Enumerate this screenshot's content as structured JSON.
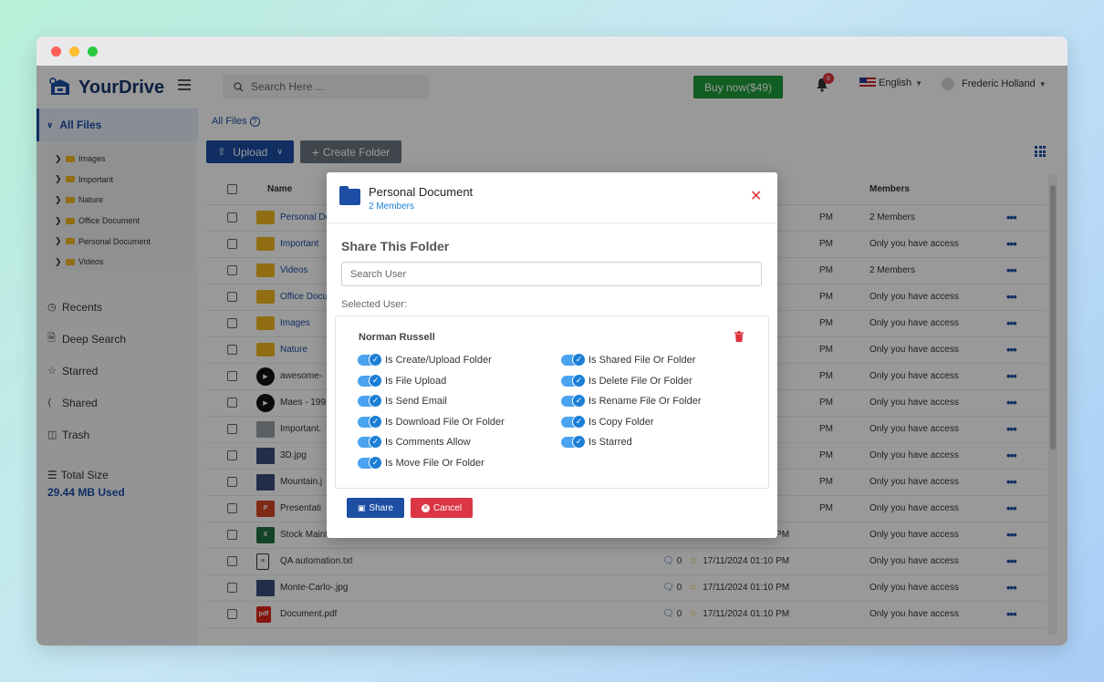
{
  "header": {
    "logo": "YourDrive",
    "search_placeholder": "Search Here ...",
    "buy_label": "Buy now($49)",
    "notification_count": "6",
    "language": "English",
    "user_name": "Frederic Holland"
  },
  "sidebar": {
    "all_files": "All Files",
    "tree": [
      "Images",
      "Important",
      "Nature",
      "Office Document",
      "Personal Document",
      "Videos"
    ],
    "nav": [
      {
        "label": "Recents",
        "icon": "clock-icon"
      },
      {
        "label": "Deep Search",
        "icon": "document-search-icon"
      },
      {
        "label": "Starred",
        "icon": "star-icon"
      },
      {
        "label": "Shared",
        "icon": "share-icon"
      },
      {
        "label": "Trash",
        "icon": "trash-icon"
      }
    ],
    "total_size_label": "Total Size",
    "used": "29.44 MB Used"
  },
  "main": {
    "breadcrumb": "All Files",
    "upload_label": "Upload",
    "create_label": "Create Folder",
    "columns": {
      "name": "Name",
      "members": "Members"
    },
    "rows": [
      {
        "name": "Personal Do",
        "type": "folder",
        "comments": "",
        "date": "PM",
        "members": "2 Members"
      },
      {
        "name": "Important",
        "type": "folder",
        "comments": "",
        "date": "PM",
        "members": "Only you have access"
      },
      {
        "name": "Videos",
        "type": "folder",
        "comments": "",
        "date": "PM",
        "members": "2 Members"
      },
      {
        "name": "Office Docu",
        "type": "folder",
        "comments": "",
        "date": "PM",
        "members": "Only you have access"
      },
      {
        "name": "Images",
        "type": "folder",
        "comments": "",
        "date": "PM",
        "members": "Only you have access"
      },
      {
        "name": "Nature",
        "type": "folder",
        "comments": "",
        "date": "PM",
        "members": "Only you have access"
      },
      {
        "name": "awesome-",
        "type": "yt",
        "comments": "",
        "date": "PM",
        "members": "Only you have access"
      },
      {
        "name": "Maes - 199",
        "type": "yt",
        "comments": "",
        "date": "PM",
        "members": "Only you have access"
      },
      {
        "name": "Important.",
        "type": "zip",
        "comments": "",
        "date": "PM",
        "members": "Only you have access"
      },
      {
        "name": "3D.jpg",
        "type": "img",
        "comments": "",
        "date": "PM",
        "members": "Only you have access"
      },
      {
        "name": "Mountain.j",
        "type": "img",
        "comments": "",
        "date": "PM",
        "members": "Only you have access"
      },
      {
        "name": "Presentati",
        "type": "ppt",
        "comments": "",
        "date": "PM",
        "members": "Only you have access"
      },
      {
        "name": "Stock Maintain.xlsx",
        "type": "xls",
        "comments": "0",
        "date": "17/11/2024 01:10 PM",
        "members": "Only you have access"
      },
      {
        "name": "QA automation.txt",
        "type": "txt",
        "comments": "0",
        "date": "17/11/2024 01:10 PM",
        "members": "Only you have access"
      },
      {
        "name": "Monte-Carlo-.jpg",
        "type": "img",
        "comments": "0",
        "date": "17/11/2024 01:10 PM",
        "members": "Only you have access"
      },
      {
        "name": "Document.pdf",
        "type": "pdf",
        "comments": "0",
        "date": "17/11/2024 01:10 PM",
        "members": "Only you have access"
      }
    ]
  },
  "modal": {
    "folder_name": "Personal Document",
    "members": "2 Members",
    "heading": "Share This Folder",
    "search_placeholder": "Search User",
    "selected_label": "Selected User:",
    "user": "Norman Russell",
    "permissions_left": [
      "Is Create/Upload Folder",
      "Is File Upload",
      "Is Send Email",
      "Is Download File Or Folder",
      "Is Comments Allow",
      "Is Move File Or Folder"
    ],
    "permissions_right": [
      "Is Shared File Or Folder",
      "Is Delete File Or Folder",
      "Is Rename File Or Folder",
      "Is Copy Folder",
      "Is Starred"
    ],
    "share_label": "Share",
    "cancel_label": "Cancel"
  },
  "colors": {
    "primary": "#1c4ea3",
    "buy": "#1f9d3a",
    "danger": "#dc3545",
    "toggle": "#1c7fd6",
    "folder": "#f2b821"
  }
}
